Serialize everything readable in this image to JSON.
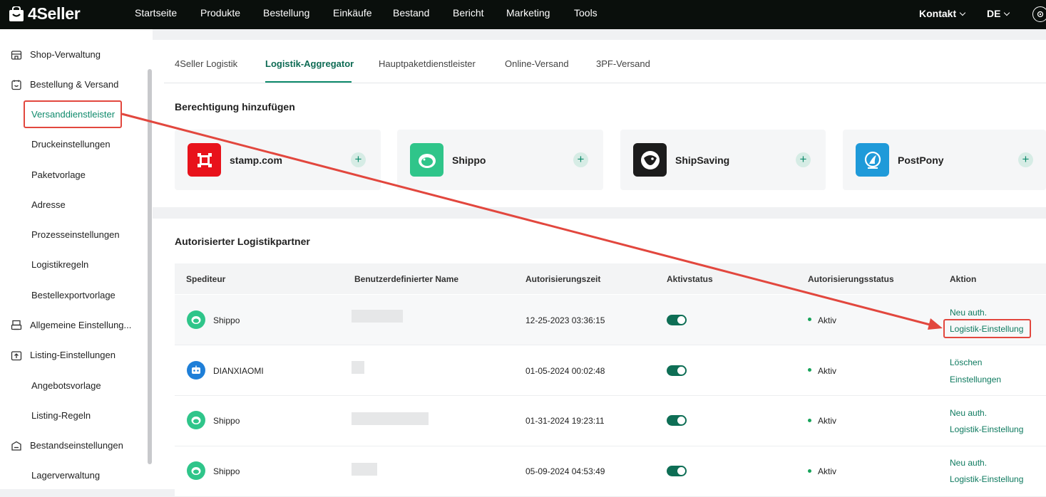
{
  "app": {
    "logo_text": "4Seller"
  },
  "top_nav": [
    "Startseite",
    "Produkte",
    "Bestellung",
    "Einkäufe",
    "Bestand",
    "Bericht",
    "Marketing",
    "Tools"
  ],
  "top_right": {
    "contact": "Kontakt",
    "language": "DE"
  },
  "sidebar": {
    "groups": [
      {
        "label": "Shop-Verwaltung",
        "icon": "shop-icon"
      },
      {
        "label": "Bestellung & Versand",
        "icon": "order-icon"
      },
      {
        "label": "Allgemeine Einstellung...",
        "icon": "printer-icon"
      },
      {
        "label": "Listing-Einstellungen",
        "icon": "upload-icon"
      },
      {
        "label": "Bestandseinstellungen",
        "icon": "stock-icon"
      }
    ],
    "items": [
      {
        "label": "Versanddienstleister",
        "active": true
      },
      {
        "label": "Druckeinstellungen"
      },
      {
        "label": "Paketvorlage"
      },
      {
        "label": "Adresse"
      },
      {
        "label": "Prozesseinstellungen"
      },
      {
        "label": "Logistikregeln"
      },
      {
        "label": "Bestellexportvorlage"
      },
      {
        "label": "Angebotsvorlage"
      },
      {
        "label": "Listing-Regeln"
      },
      {
        "label": "Lagerverwaltung"
      }
    ]
  },
  "tabs": [
    "4Seller Logistik",
    "Logistik-Aggregator",
    "Hauptpaketdienstleister",
    "Online-Versand",
    "3PF-Versand"
  ],
  "active_tab": "Logistik-Aggregator",
  "add_section": {
    "title": "Berechtigung hinzufügen",
    "cards": [
      {
        "name": "stamp.com",
        "color": "#e8121b"
      },
      {
        "name": "Shippo",
        "color": "#2fc58a"
      },
      {
        "name": "ShipSaving",
        "color": "#1c1c1c"
      },
      {
        "name": "PostPony",
        "color": "#1f9ad9"
      }
    ],
    "plus": "+"
  },
  "partners": {
    "title": "Autorisierter Logistikpartner",
    "columns": [
      "Spediteur",
      "Benutzerdefinierter Name",
      "Autorisierungszeit",
      "Aktivstatus",
      "Autorisierungsstatus",
      "Aktion"
    ],
    "rows": [
      {
        "carrier": "Shippo",
        "time": "12-25-2023 03:36:15",
        "status": "Aktiv",
        "actions": [
          "Neu auth.",
          "Logistik-Einstellung"
        ]
      },
      {
        "carrier": "DIANXIAOMI",
        "time": "01-05-2024 00:02:48",
        "status": "Aktiv",
        "actions": [
          "Löschen",
          "Einstellungen"
        ]
      },
      {
        "carrier": "Shippo",
        "time": "01-31-2024 19:23:11",
        "status": "Aktiv",
        "actions": [
          "Neu auth.",
          "Logistik-Einstellung"
        ]
      },
      {
        "carrier": "Shippo",
        "time": "05-09-2024 04:53:49",
        "status": "Aktiv",
        "actions": [
          "Neu auth.",
          "Logistik-Einstellung"
        ]
      }
    ]
  },
  "colors": {
    "accent": "#0e8a6b",
    "annotation": "#e2473e",
    "topbar": "#0a0f0c"
  }
}
